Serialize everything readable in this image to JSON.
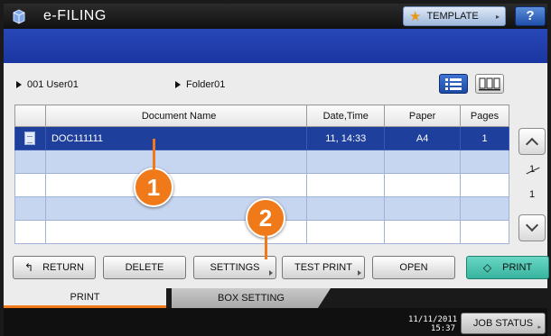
{
  "header": {
    "app_title": "e-FILING",
    "template_label": "TEMPLATE",
    "help_label": "?"
  },
  "breadcrumb": {
    "box": "001 User01",
    "folder": "Folder01"
  },
  "table": {
    "columns": [
      "Document Name",
      "Date,Time",
      "Paper",
      "Pages"
    ],
    "rows": [
      {
        "name": "DOC111111",
        "datetime": "11, 14:33",
        "paper": "A4",
        "pages": "1"
      }
    ]
  },
  "pager": {
    "current": "1",
    "total": "1"
  },
  "buttons": {
    "return": "RETURN",
    "delete": "DELETE",
    "settings": "SETTINGS",
    "test_print": "TEST PRINT",
    "open": "OPEN",
    "print": "PRINT"
  },
  "markers": {
    "one": "1",
    "two": "2"
  },
  "tabs": {
    "print": "PRINT",
    "box_setting": "BOX SETTING"
  },
  "status": {
    "date": "11/11/2011",
    "time": "15:37",
    "job_status": "JOB STATUS"
  },
  "colors": {
    "accent": "#f07a1a",
    "selected_row": "#1f3f9c",
    "print_button": "#36b49f"
  }
}
